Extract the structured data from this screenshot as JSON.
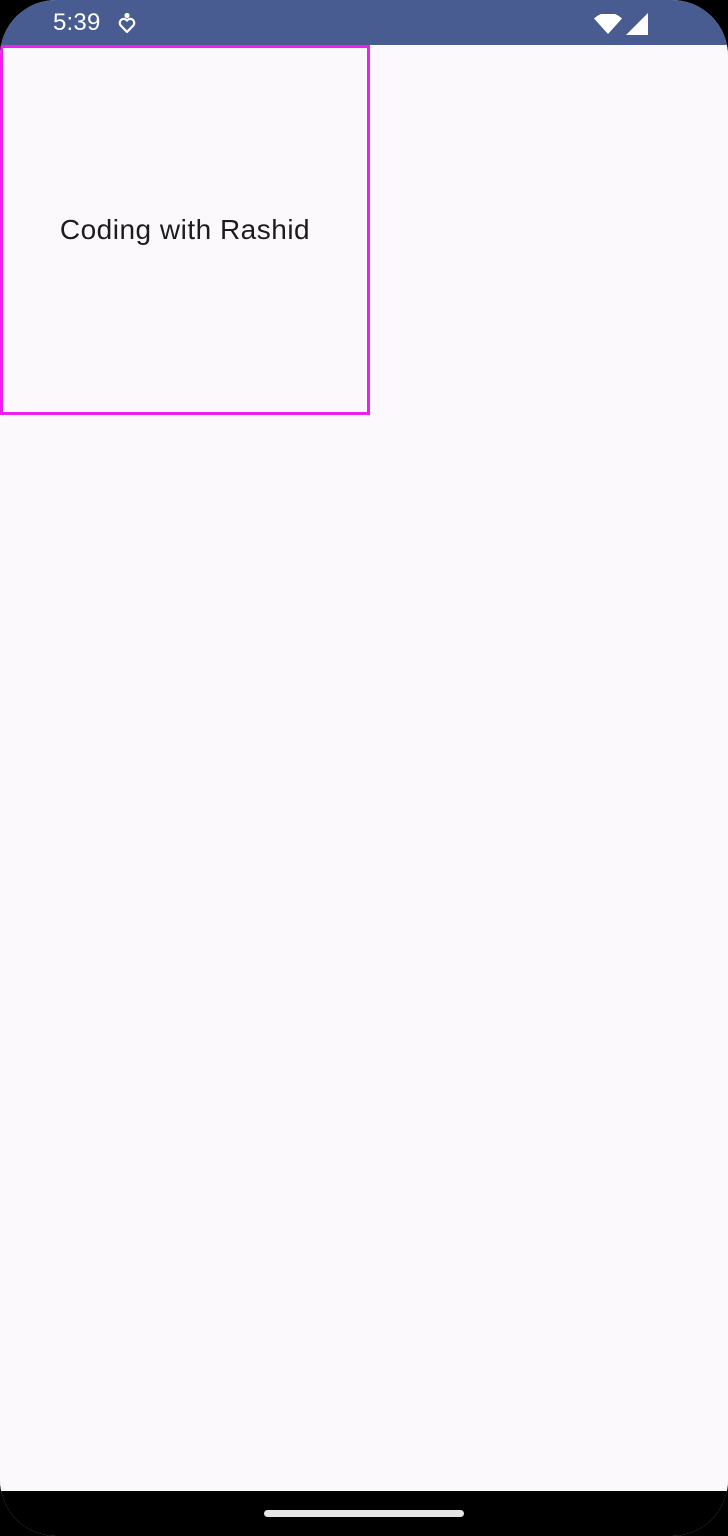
{
  "status_bar": {
    "time": "5:39",
    "background": "#495c92",
    "notification_icon": "accessibility-heart-icon",
    "wifi_icon": "wifi-icon",
    "signal_icon": "cell-signal-icon"
  },
  "main": {
    "background": "#fcf9fc",
    "box": {
      "label": "Coding with Rashid",
      "border_color": "#ef1ff0"
    }
  },
  "nav_bar": {
    "background": "#000000",
    "handle_icon": "home-gesture-handle"
  }
}
